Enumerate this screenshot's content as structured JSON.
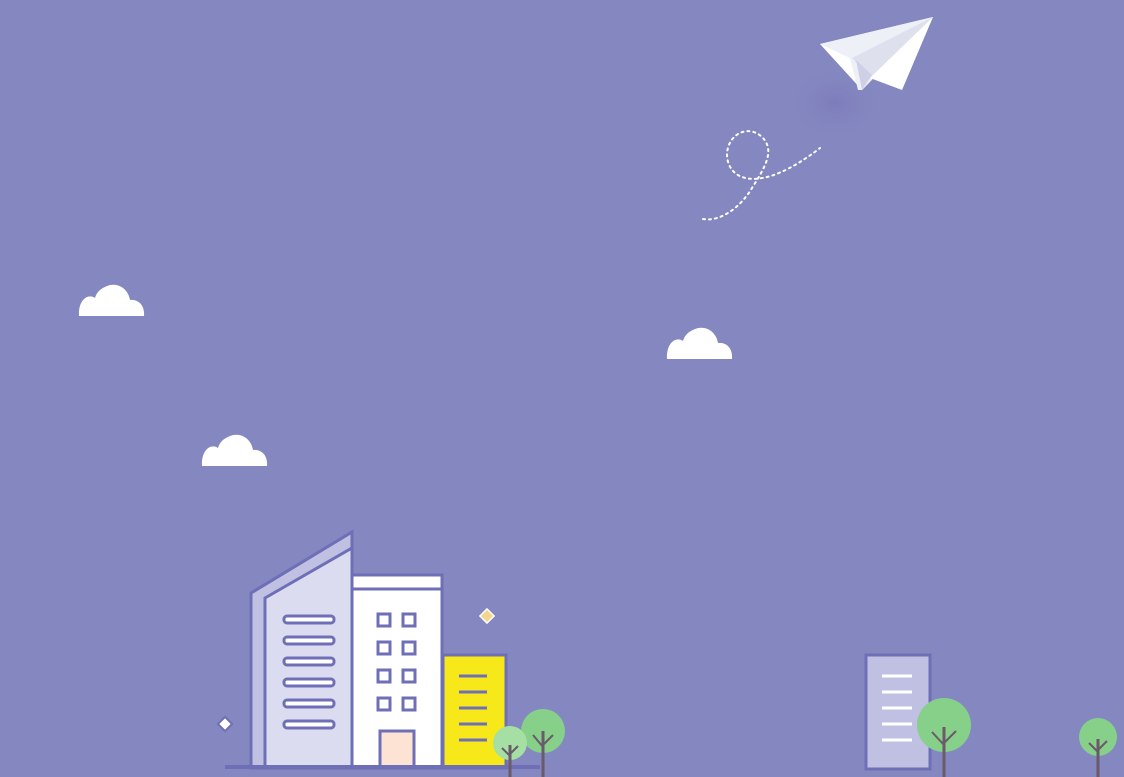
{
  "scene": {
    "background_color": "#8487c0",
    "accent_yellow": "#f7e81a",
    "building_stroke": "#6e6fb6",
    "building_fill_light": "#dcdcf0",
    "building_fill_white": "#ffffff",
    "tree_color": "#86d08a",
    "door_color": "#fde3d3",
    "icons": [
      "paper-plane-icon",
      "cloud-icon",
      "building-icon",
      "tree-icon",
      "sparkle-icon"
    ]
  }
}
